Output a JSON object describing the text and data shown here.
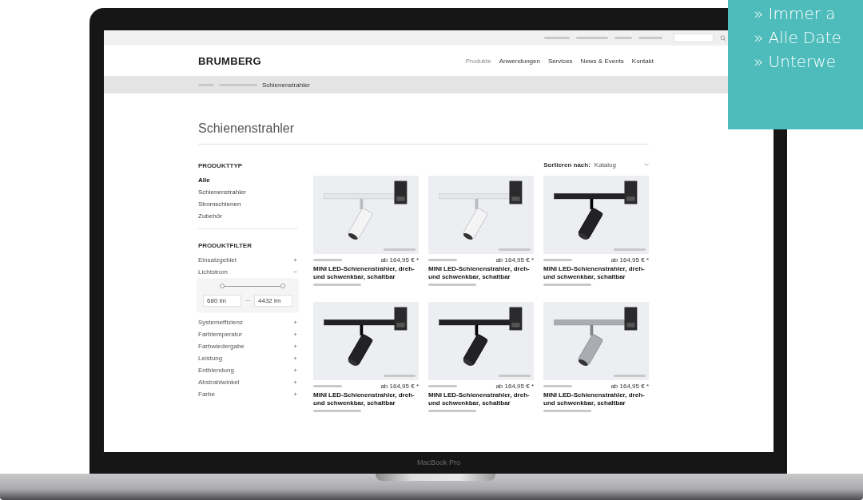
{
  "promo": {
    "lines": [
      "» Immer a",
      "» Alle Date",
      "» Unterwe"
    ]
  },
  "site": {
    "logo": "BRUMBERG",
    "nav": [
      {
        "label": "Produkte",
        "selected": true
      },
      {
        "label": "Anwendungen",
        "selected": false
      },
      {
        "label": "Services",
        "selected": false
      },
      {
        "label": "News & Events",
        "selected": false
      },
      {
        "label": "Kontakt",
        "selected": false
      }
    ],
    "breadcrumb": "Schienenstrahler",
    "title": "Schienenstrahler",
    "product_type": {
      "heading": "PRODUKTTYP",
      "items": [
        {
          "label": "Alle",
          "selected": true
        },
        {
          "label": "Schienenstrahler",
          "selected": false
        },
        {
          "label": "Stromschienen",
          "selected": false
        },
        {
          "label": "Zubehör",
          "selected": false
        }
      ]
    },
    "filters": {
      "heading": "PRODUKTFILTER",
      "items": [
        {
          "label": "Einsatzgebiet",
          "expanded": false
        },
        {
          "label": "Lichtstrom",
          "expanded": true
        },
        {
          "label": "Systemeffizienz",
          "expanded": false
        },
        {
          "label": "Farbtemperatur",
          "expanded": false
        },
        {
          "label": "Farbwiedergabe",
          "expanded": false
        },
        {
          "label": "Leistung",
          "expanded": false
        },
        {
          "label": "Entblendung",
          "expanded": false
        },
        {
          "label": "Abstrahlwinkel",
          "expanded": false
        },
        {
          "label": "Farbe",
          "expanded": false
        }
      ],
      "slider": {
        "thumbs": [
          {
            "level": 0
          },
          {
            "level": 1
          }
        ],
        "min": {
          "value": "680",
          "unit": "lm"
        },
        "max": {
          "value": "4432",
          "unit": "lm"
        }
      }
    },
    "sort": {
      "label": "Sortieren nach:",
      "value": "Katalog"
    },
    "products": [
      {
        "color": "#f4f4f4",
        "price": "ab 164,95 € *",
        "name": "MINI LED-Schienenstrahler, dreh- und schwenkbar, schaltbar"
      },
      {
        "color": "#f4f4f4",
        "price": "ab 164,95 € *",
        "name": "MINI LED-Schienenstrahler, dreh- und schwenkbar, schaltbar"
      },
      {
        "color": "#222224",
        "price": "ab 164,95 € *",
        "name": "MINI LED-Schienenstrahler, dreh- und schwenkbar, schaltbar"
      },
      {
        "color": "#222224",
        "price": "ab 164,95 € *",
        "name": "MINI LED-Schienenstrahler, dreh- und schwenkbar, schaltbar"
      },
      {
        "color": "#222224",
        "price": "ab 164,95 € *",
        "name": "MINI LED-Schienenstrahler, dreh- und schwenkbar, schaltbar"
      },
      {
        "color": "#a9adb2",
        "price": "ab 164,95 € *",
        "name": "MINI LED-Schienenstrahler, dreh- und schwenkbar, schaltbar"
      }
    ]
  },
  "device_label": "MacBook Pro"
}
